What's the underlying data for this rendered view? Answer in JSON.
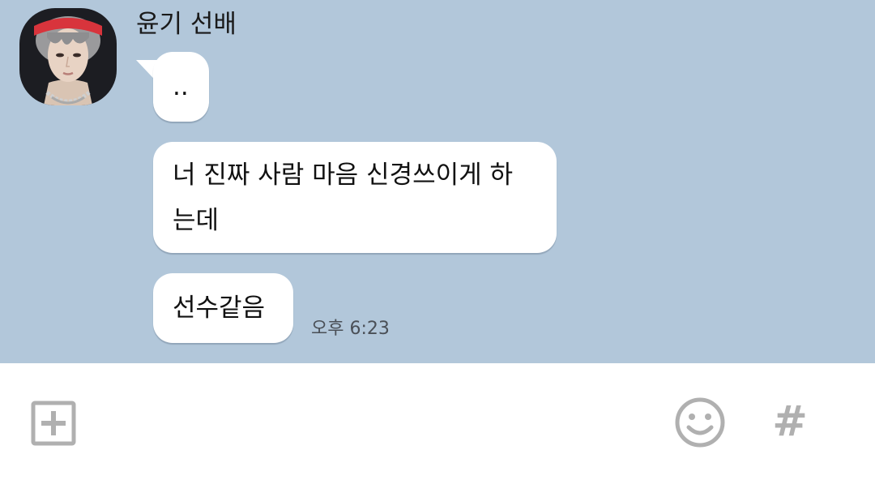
{
  "chat": {
    "background_color": "#b2c7da",
    "sender": {
      "name": "윤기 선배",
      "avatar_icon": "profile-photo"
    },
    "messages": [
      {
        "text_lines": [
          ".."
        ]
      },
      {
        "text_lines": [
          "너 진짜 사람 마음 신경쓰이게 하",
          "는데"
        ]
      },
      {
        "text_lines": [
          "선수같음"
        ],
        "time": "오후 6:23"
      }
    ]
  },
  "input_bar": {
    "add_icon": "plus-square-icon",
    "emoji_icon": "smiley-icon",
    "hash_label": "#",
    "icon_color": "#b0b0b0"
  }
}
